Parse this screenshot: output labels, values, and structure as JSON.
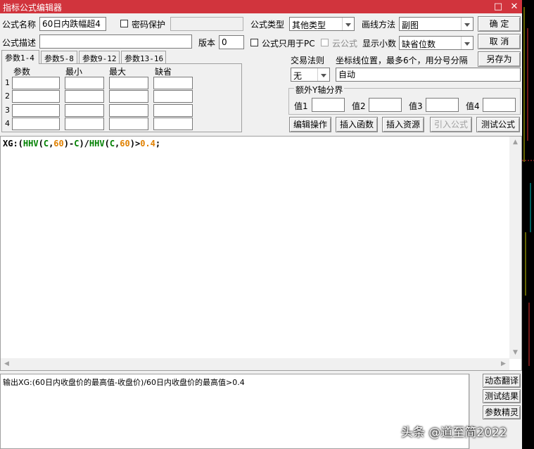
{
  "window": {
    "title": "指标公式编辑器",
    "restore_icon": "restore-icon",
    "close_icon": "close-icon"
  },
  "form": {
    "name_label": "公式名称",
    "name_value": "60日内跌幅超4",
    "password_label": "密码保护",
    "type_label": "公式类型",
    "type_value": "其他类型",
    "draw_label": "画线方法",
    "draw_value": "副图",
    "desc_label": "公式描述",
    "desc_value": "",
    "version_label": "版本",
    "version_value": "0",
    "pc_only_label": "公式只用于PC",
    "cloud_label": "云公式",
    "decimals_label": "显示小数",
    "decimals_value": "缺省位数",
    "ok_label": "确  定",
    "cancel_label": "取  消",
    "saveas_label": "另存为"
  },
  "tabs": [
    "参数1-4",
    "参数5-8",
    "参数9-12",
    "参数13-16"
  ],
  "params": {
    "headers": [
      "参数",
      "最小",
      "最大",
      "缺省"
    ],
    "rows": [
      "1",
      "2",
      "3",
      "4"
    ]
  },
  "trade": {
    "rule_label": "交易法则",
    "rule_value": "无",
    "axis_hint": "坐标线位置，最多6个，用分号分隔",
    "axis_value": "自动",
    "extra_axis_label": "额外Y轴分界",
    "value_labels": [
      "值1",
      "值2",
      "值3",
      "值4"
    ]
  },
  "actions": [
    "编辑操作",
    "插入函数",
    "插入资源",
    "引入公式",
    "测试公式"
  ],
  "code": {
    "p1": "XG:(",
    "p2": "HHV",
    "p3": "(",
    "p4": "C",
    "p5": ",",
    "p6": "60",
    "p7": ")-",
    "p8": "C",
    "p9": ")/",
    "p10": "HHV",
    "p11": "(",
    "p12": "C",
    "p13": ",",
    "p14": "60",
    "p15": ")>",
    "p16": "0.4",
    "p17": ";"
  },
  "output_text": "输出XG:(60日内收盘价的最高值-收盘价)/60日内收盘价的最高值>0.4",
  "side_buttons": [
    "动态翻译",
    "测试结果",
    "参数精灵"
  ],
  "watermark": "头条 @道至简2022",
  "colors": {
    "titlebar": "#d1343d",
    "code_fn": "#008000",
    "code_num": "#e08000",
    "code_var": "#0000c0"
  }
}
